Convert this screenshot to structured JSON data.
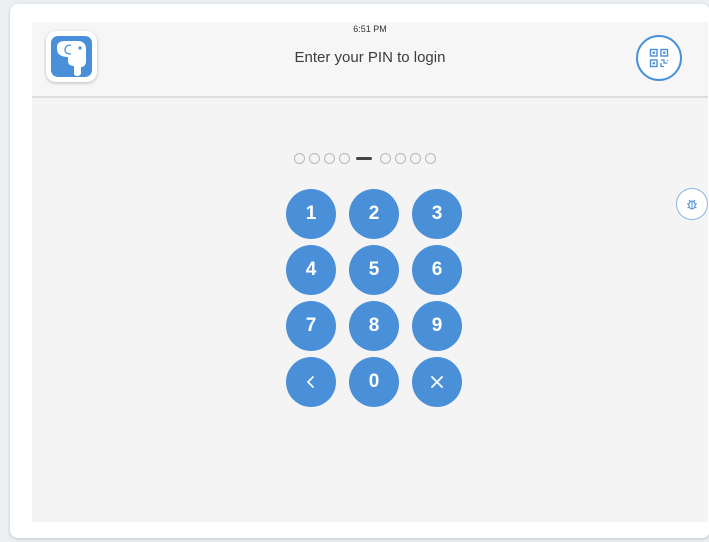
{
  "status_bar": {
    "time": "6:51 PM"
  },
  "header": {
    "title": "Enter your PIN to login",
    "logo_icon": "elephant-app-icon",
    "qr_icon": "qr-code-icon"
  },
  "pin_indicator": {
    "digits_entered": 0,
    "group_size": 4
  },
  "keypad": {
    "keys": [
      {
        "label": "1",
        "kind": "digit"
      },
      {
        "label": "2",
        "kind": "digit"
      },
      {
        "label": "3",
        "kind": "digit"
      },
      {
        "label": "4",
        "kind": "digit"
      },
      {
        "label": "5",
        "kind": "digit"
      },
      {
        "label": "6",
        "kind": "digit"
      },
      {
        "label": "7",
        "kind": "digit"
      },
      {
        "label": "8",
        "kind": "digit"
      },
      {
        "label": "9",
        "kind": "digit"
      },
      {
        "label": "",
        "kind": "back",
        "icon": "chevron-left-icon"
      },
      {
        "label": "0",
        "kind": "digit"
      },
      {
        "label": "",
        "kind": "clear",
        "icon": "close-icon"
      }
    ]
  },
  "debug": {
    "icon": "bug-icon"
  },
  "colors": {
    "accent": "#4a90d9",
    "background": "#f4f4f4",
    "header_background": "#f6f6f6",
    "text": "#3c3c3c"
  }
}
